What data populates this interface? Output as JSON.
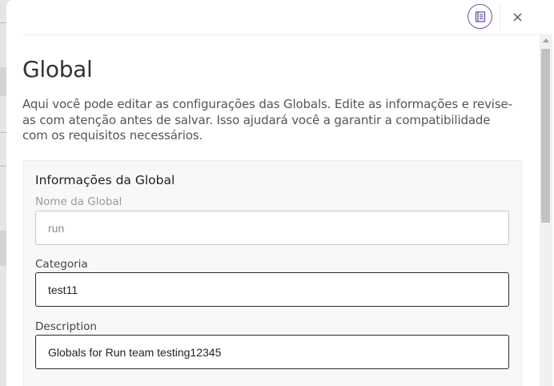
{
  "header": {
    "docs_icon": "document-list-icon",
    "close_icon": "close-x-icon"
  },
  "page": {
    "title": "Global",
    "description": "Aqui você pode editar as configurações das Globals. Edite as informações e revise-as com atenção antes de salvar. Isso ajudará você a garantir a compatibilidade com os requisitos necessários."
  },
  "card": {
    "title": "Informações da Global",
    "fields": [
      {
        "label": "Nome da Global",
        "value": "run",
        "disabled": true
      },
      {
        "label": "Categoria",
        "value": "test11",
        "disabled": false
      },
      {
        "label": "Description",
        "value": "Globals for Run team testing12345",
        "disabled": false
      }
    ]
  },
  "colors": {
    "accent": "#6b4fa3",
    "title_text": "#333333",
    "card_background": "#f8f8f8",
    "active_border": "#2b2b2b",
    "disabled_border": "#c8c8c8"
  }
}
